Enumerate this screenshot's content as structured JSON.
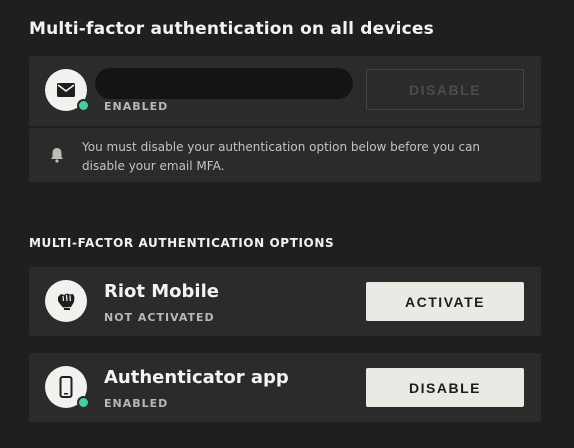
{
  "page_title": "Multi-factor authentication on all devices",
  "email_mfa": {
    "icon": "envelope-icon",
    "status": "ENABLED",
    "button_label": "DISABLE",
    "status_color": "#3fd1a0"
  },
  "notice": {
    "icon": "bell-icon",
    "text": "You must disable your authentication option below before you can disable your email MFA."
  },
  "options_heading": "MULTI-FACTOR AUTHENTICATION OPTIONS",
  "options": [
    {
      "name": "Riot Mobile",
      "icon": "riot-fist-icon",
      "status": "NOT ACTIVATED",
      "button_label": "ACTIVATE"
    },
    {
      "name": "Authenticator app",
      "icon": "phone-icon",
      "status": "ENABLED",
      "button_label": "DISABLE",
      "status_color": "#3fd1a0"
    }
  ]
}
